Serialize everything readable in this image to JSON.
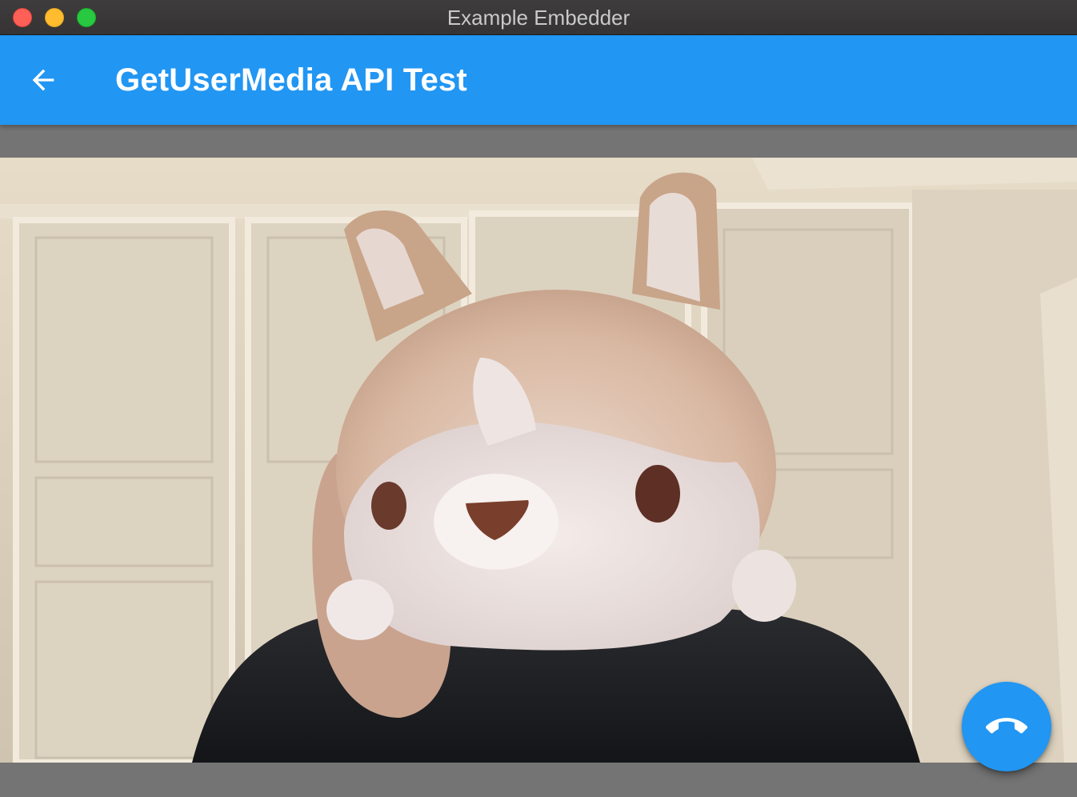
{
  "window": {
    "title": "Example Embedder",
    "buttons": [
      "close",
      "minimize",
      "maximize"
    ]
  },
  "appbar": {
    "title": "GetUserMedia API Test",
    "back_icon": "arrow-back-icon",
    "background": "#2196f3"
  },
  "video": {
    "content": "camera-preview"
  },
  "fab": {
    "icon": "call-end-icon",
    "background": "#2196f3"
  }
}
